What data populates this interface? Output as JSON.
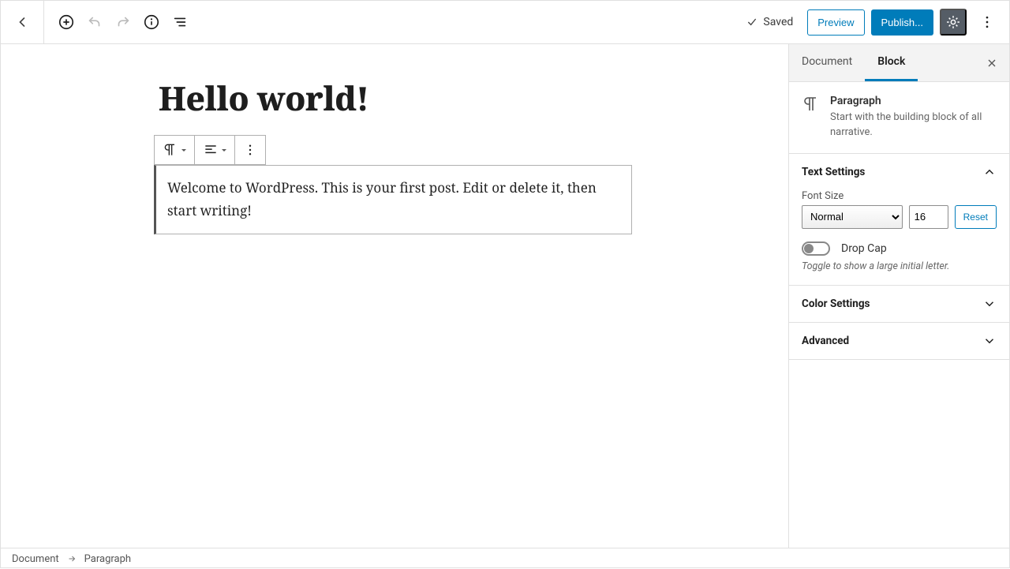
{
  "toolbar": {
    "saved_label": "Saved",
    "preview_label": "Preview",
    "publish_label": "Publish..."
  },
  "post": {
    "title": "Hello world!",
    "paragraph": "Welcome to WordPress. This is your first post. Edit or delete it, then start writing!"
  },
  "sidebar": {
    "tabs": {
      "document": "Document",
      "block": "Block"
    },
    "block_info": {
      "name": "Paragraph",
      "desc": "Start with the building block of all narrative."
    },
    "text_settings": {
      "title": "Text Settings",
      "font_size_label": "Font Size",
      "font_size_preset": "Normal",
      "font_size_value": "16",
      "reset_label": "Reset",
      "drop_cap_label": "Drop Cap",
      "drop_cap_help": "Toggle to show a large initial letter."
    },
    "color_settings_title": "Color Settings",
    "advanced_title": "Advanced"
  },
  "breadcrumb": {
    "a": "Document",
    "b": "Paragraph"
  }
}
